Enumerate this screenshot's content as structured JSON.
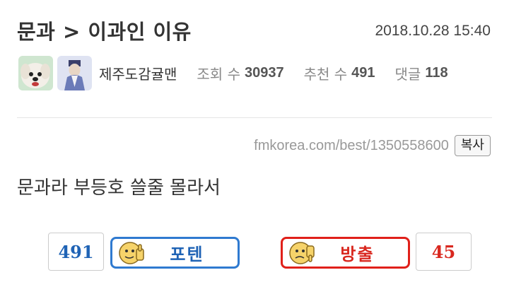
{
  "post": {
    "title": "문과 > 이과인 이유",
    "date": "2018.10.28 15:40",
    "author": "제주도감귤맨",
    "views_label": "조회 수",
    "views": "30937",
    "recommend_label": "추천 수",
    "recommend": "491",
    "comments_label": "댓글",
    "comments": "118",
    "url": "fmkorea.com/best/1350558600",
    "copy_label": "복사",
    "body": "문과라 부등호 쓸줄 몰라서"
  },
  "votes": {
    "up_count": "491",
    "up_label": "포텐",
    "down_count": "45",
    "down_label": "방출",
    "up_color": "#2f7ad0",
    "down_color": "#e0201a"
  }
}
